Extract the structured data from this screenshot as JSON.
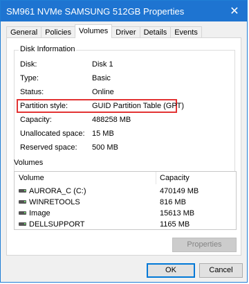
{
  "window": {
    "title": "SM961 NVMe SAMSUNG 512GB Properties"
  },
  "tabs": [
    {
      "label": "General"
    },
    {
      "label": "Policies"
    },
    {
      "label": "Volumes"
    },
    {
      "label": "Driver"
    },
    {
      "label": "Details"
    },
    {
      "label": "Events"
    }
  ],
  "disk_info": {
    "title": "Disk Information",
    "rows": [
      {
        "label": "Disk:",
        "value": "Disk 1"
      },
      {
        "label": "Type:",
        "value": "Basic"
      },
      {
        "label": "Status:",
        "value": "Online"
      },
      {
        "label": "Partition style:",
        "value": "GUID Partition Table (GPT)"
      },
      {
        "label": "Capacity:",
        "value": "488258 MB"
      },
      {
        "label": "Unallocated space:",
        "value": "15 MB"
      },
      {
        "label": "Reserved space:",
        "value": "500 MB"
      }
    ]
  },
  "volumes": {
    "label": "Volumes",
    "col_volume": "Volume",
    "col_capacity": "Capacity",
    "items": [
      {
        "name": "AURORA_C (C:)",
        "capacity": "470149 MB"
      },
      {
        "name": "WINRETOOLS",
        "capacity": "816 MB"
      },
      {
        "name": "Image",
        "capacity": "15613 MB"
      },
      {
        "name": "DELLSUPPORT",
        "capacity": "1165 MB"
      }
    ]
  },
  "buttons": {
    "properties": "Properties",
    "ok": "OK",
    "cancel": "Cancel"
  },
  "colors": {
    "titlebar": "#1e74d1",
    "highlight": "#e23333"
  }
}
